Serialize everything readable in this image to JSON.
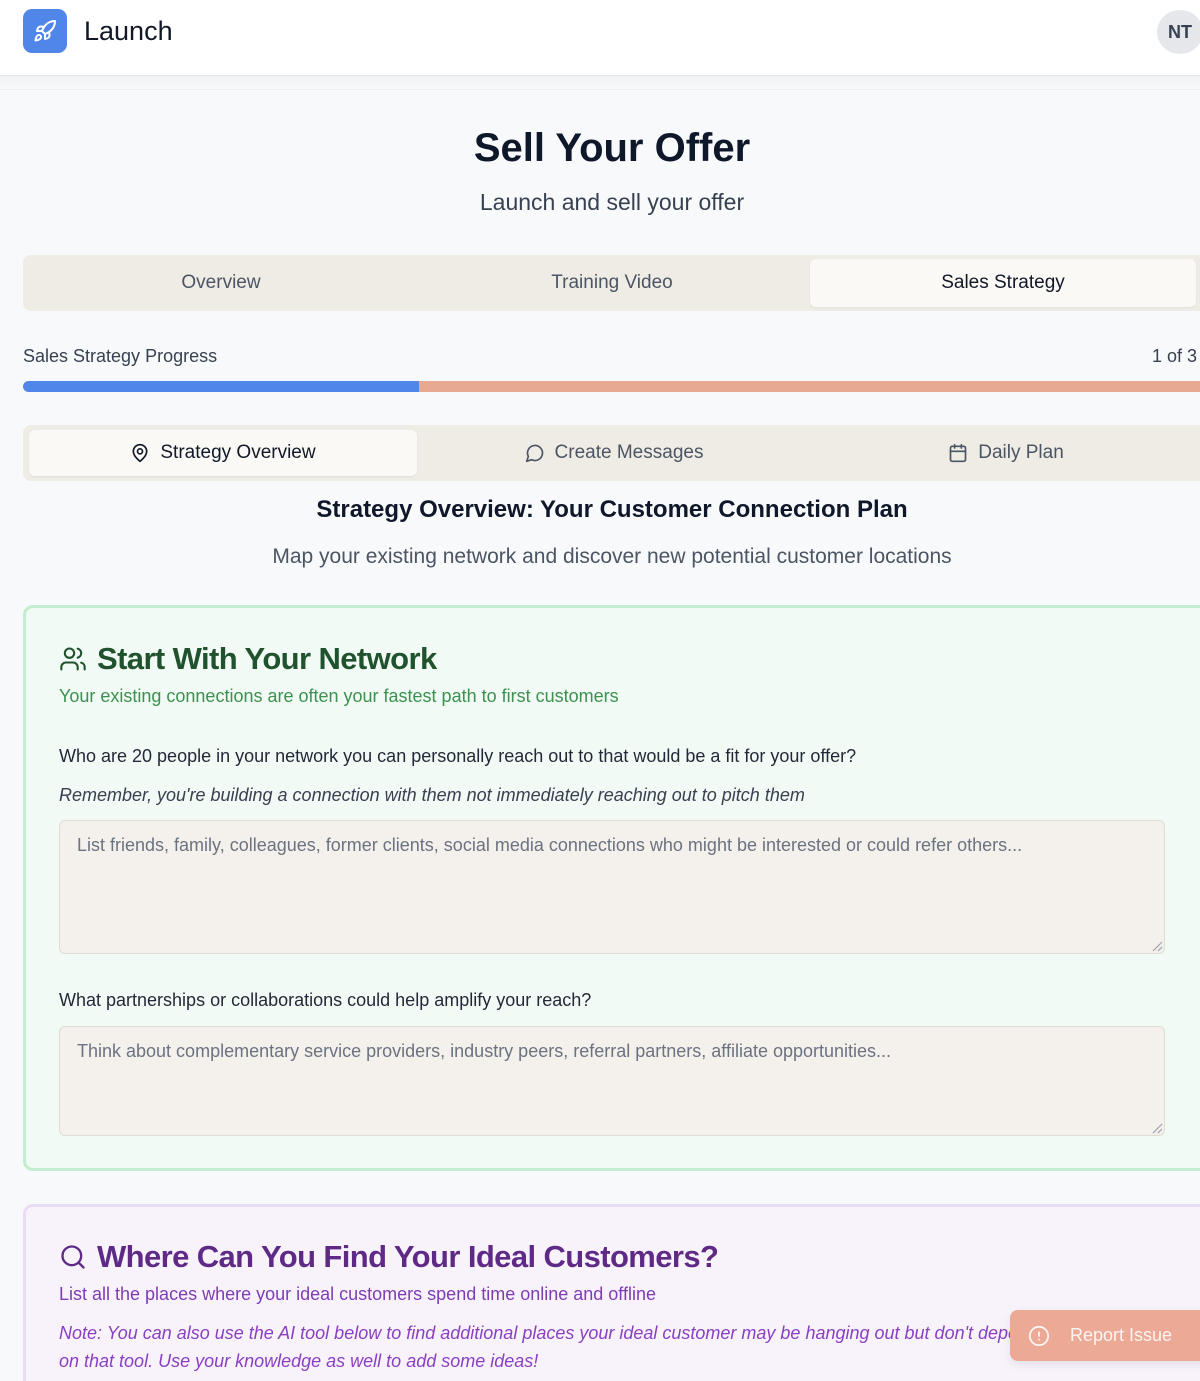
{
  "header": {
    "app_name": "Launch",
    "logo_icon": "rocket-icon",
    "avatar_initials": "NT"
  },
  "page": {
    "title": "Sell Your Offer",
    "subtitle": "Launch and sell your offer"
  },
  "main_tabs": [
    {
      "label": "Overview",
      "active": false
    },
    {
      "label": "Training Video",
      "active": false
    },
    {
      "label": "Sales Strategy",
      "active": true
    }
  ],
  "progress": {
    "label": "Sales Strategy Progress",
    "count_text": "1 of 3",
    "fraction": 0.333,
    "fill_color": "#4f86e8",
    "track_color": "#e8a993"
  },
  "sub_tabs": [
    {
      "label": "Strategy Overview",
      "icon": "map-pin-icon",
      "active": true
    },
    {
      "label": "Create Messages",
      "icon": "message-circle-icon",
      "active": false
    },
    {
      "label": "Daily Plan",
      "icon": "calendar-icon",
      "active": false
    }
  ],
  "section": {
    "title": "Strategy Overview: Your Customer Connection Plan",
    "subtitle": "Map your existing network and discover new potential customer locations"
  },
  "network_card": {
    "icon": "users-icon",
    "title": "Start With Your Network",
    "subtitle": "Your existing connections are often your fastest path to first customers",
    "question_1": "Who are 20 people in your network you can personally reach out to that would be a fit for your offer?",
    "hint_1": "Remember, you're building a connection with them not immediately reaching out to pitch them",
    "placeholder_1": "List friends, family, colleagues, former clients, social media connections who might be interested or could refer others...",
    "value_1": "",
    "question_2": "What partnerships or collaborations could help amplify your reach?",
    "placeholder_2": "Think about complementary service providers, industry peers, referral partners, affiliate opportunities...",
    "value_2": "",
    "accent_color": "#21522e"
  },
  "customers_card": {
    "icon": "search-icon",
    "title": "Where Can You Find Your Ideal Customers?",
    "subtitle": "List all the places where your ideal customers spend time online and offline",
    "note": "Note: You can also use the AI tool below to find additional places your ideal customer may be hanging out but don't depend on that tool. Use your knowledge as well to add some ideas!",
    "accent_color": "#5e2a86"
  },
  "report_button": {
    "label": "Report Issue",
    "icon": "alert-circle-icon"
  }
}
